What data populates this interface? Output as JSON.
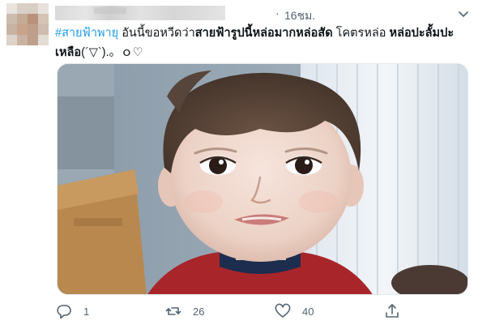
{
  "tweet": {
    "separator": "·",
    "timestamp": "16ชม.",
    "hashtag": "#สายฟ้าพายุ",
    "text_part1": " อันนี้ขอหวีดว่า",
    "text_bold1": "สายฟ้ารูปนี้หล่อมากหล่อสัด",
    "text_part2": " โคตรหล่อ ",
    "text_bold2": "หล่อปะลั้มปะเหลือ",
    "text_part3": "(´▽`).。ｏ♡"
  },
  "actions": {
    "reply_count": "1",
    "retweet_count": "26",
    "like_count": "40"
  },
  "colors": {
    "link": "#1d9bf0",
    "muted": "#536471",
    "text": "#0f1419"
  },
  "icons": {
    "more": "chevron-down-icon",
    "reply": "reply-icon",
    "retweet": "retweet-icon",
    "like": "heart-icon",
    "share": "share-icon"
  }
}
